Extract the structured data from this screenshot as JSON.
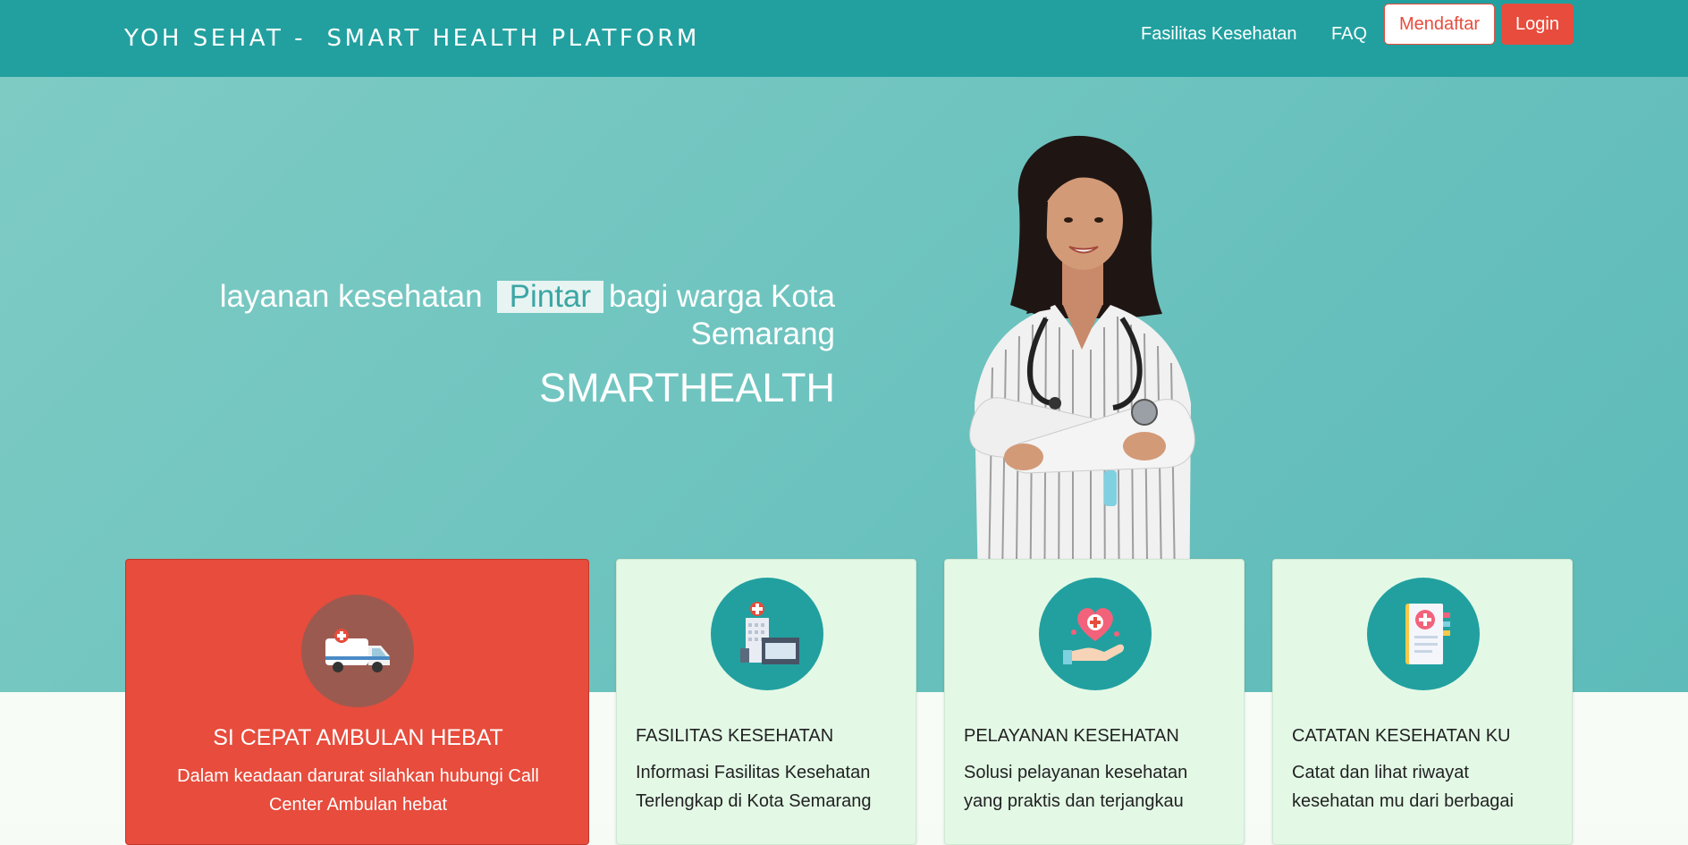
{
  "navbar": {
    "brand": "YOH SEHAT -  SMART HEALTH PLATFORM",
    "links": [
      {
        "label": "Fasilitas Kesehatan"
      },
      {
        "label": "FAQ"
      }
    ],
    "register_label": "Mendaftar",
    "login_label": "Login"
  },
  "hero": {
    "tagline_before": "layanan kesehatan",
    "tagline_highlight": "Pintar",
    "tagline_after": "bagi warga Kota",
    "tagline_line2": "Semarang",
    "title": "SMARTHEALTH"
  },
  "cards": [
    {
      "icon": "ambulance-icon",
      "title": "SI CEPAT AMBULAN HEBAT",
      "description": "Dalam keadaan darurat silahkan hubungi Call Center Ambulan hebat"
    },
    {
      "icon": "hospital-icon",
      "title": "FASILITAS KESEHATAN",
      "description": "Informasi Fasilitas Kesehatan Terlengkap di Kota Semarang"
    },
    {
      "icon": "heart-hand-icon",
      "title": "PELAYANAN KESEHATAN",
      "description": "Solusi pelayanan kesehatan yang praktis dan terjangkau"
    },
    {
      "icon": "medical-record-icon",
      "title": "CATATAN KESEHATAN KU",
      "description": "Catat dan lihat riwayat kesehatan mu dari berbagai"
    }
  ],
  "colors": {
    "navbar": "#22a0a0",
    "accent_red": "#e74c3c",
    "card_green": "#e3f9e6"
  }
}
